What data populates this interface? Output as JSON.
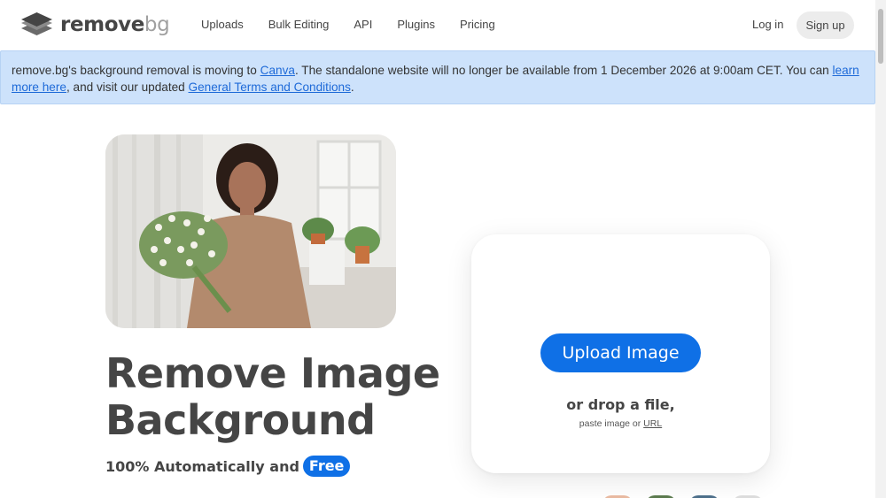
{
  "header": {
    "logo": {
      "name": "remove",
      "suffix": "bg"
    },
    "nav": [
      {
        "label": "Uploads"
      },
      {
        "label": "Bulk Editing"
      },
      {
        "label": "API"
      },
      {
        "label": "Plugins"
      },
      {
        "label": "Pricing"
      }
    ],
    "login_label": "Log in",
    "signup_label": "Sign up"
  },
  "banner": {
    "part1": "remove.bg's background removal is moving to ",
    "link_canva": "Canva",
    "part2": ". The standalone website will no longer be available from 1 December 2026 at 9:00am CET. You can ",
    "link_learn_more": "learn more here",
    "part3": ", and visit our updated ",
    "link_terms": "General Terms and Conditions",
    "part4": "."
  },
  "hero": {
    "headline_line1": "Remove Image",
    "headline_line2": "Background",
    "subline": "100% Automatically and",
    "badge": "Free"
  },
  "upload": {
    "button_label": "Upload Image",
    "drop_text": "or drop a file,",
    "paste_prefix": "paste image or ",
    "paste_url_link": "URL"
  },
  "colors": {
    "accent": "#0f70e6",
    "banner_bg": "#cde2fb",
    "text": "#454545"
  },
  "icons": {
    "logo": "layered-diamond-logo-icon"
  }
}
